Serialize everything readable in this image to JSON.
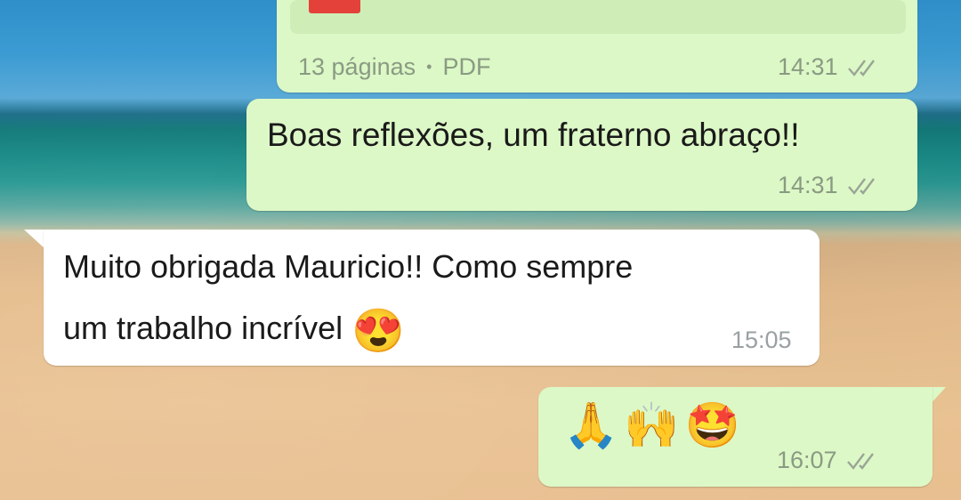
{
  "messages": [
    {
      "type": "document",
      "direction": "outgoing",
      "pages": "13 páginas",
      "separator": "•",
      "file_type": "PDF",
      "time": "14:31",
      "status_icon": "double-check-icon"
    },
    {
      "type": "text",
      "direction": "outgoing",
      "text": "Boas reflexões, um fraterno abraço!!",
      "time": "14:31",
      "status_icon": "double-check-icon"
    },
    {
      "type": "text",
      "direction": "incoming",
      "line1": "Muito obrigada Mauricio!! Como sempre",
      "line2": "um trabalho incrível",
      "emoji": "😍",
      "time": "15:05"
    },
    {
      "type": "emoji",
      "direction": "outgoing",
      "emojis": "🙏🙌🤩",
      "time": "16:07",
      "status_icon": "double-check-icon"
    }
  ],
  "colors": {
    "outgoing_bubble": "#dcf8c6",
    "incoming_bubble": "#ffffff",
    "pdf_badge": "#e3413a",
    "meta_text": "#8a9a83"
  }
}
